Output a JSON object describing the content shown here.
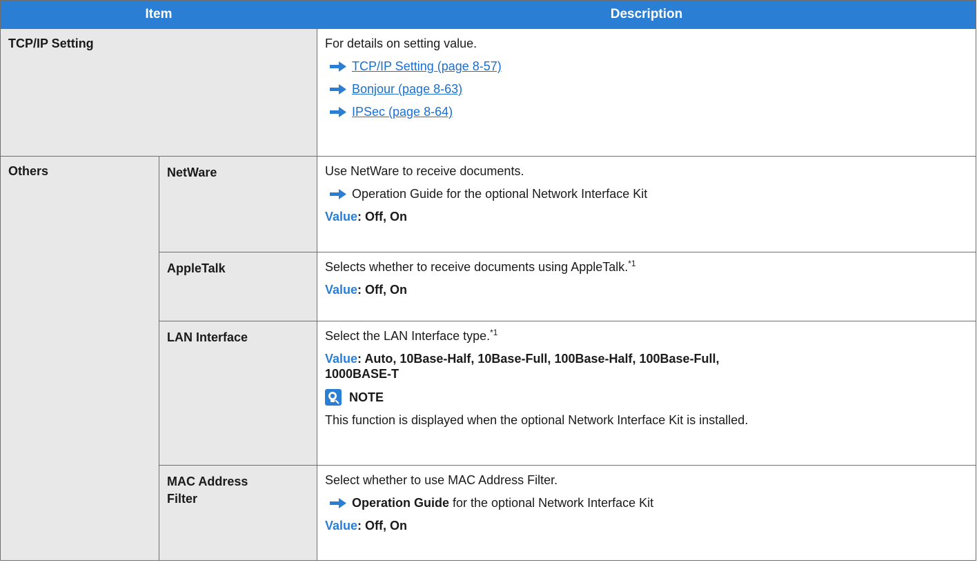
{
  "header": {
    "item": "Item",
    "description": "Description"
  },
  "tcpip": {
    "item": "TCP/IP Setting",
    "intro": "For details on setting value.",
    "links": [
      {
        "text": "TCP/IP Setting (page 8-57)",
        "icon": "right-arrow-icon"
      },
      {
        "text": "Bonjour (page 8-63)",
        "icon": "right-arrow-icon"
      },
      {
        "text": "IPSec (page 8-64)",
        "icon": "right-arrow-icon"
      }
    ]
  },
  "others": {
    "item": "Others",
    "netware": {
      "name": "NetWare",
      "text": "Use NetWare to receive documents.",
      "ref": "Operation Guide for the optional Network Interface Kit",
      "value_label": "Value",
      "value": ": Off, On"
    },
    "appletalk": {
      "name": "AppleTalk",
      "text": "Selects whether to receive documents using AppleTalk.",
      "footnote": "*1",
      "value_label": "Value",
      "value": ": Off, On"
    },
    "lan": {
      "name": "LAN Interface",
      "text": "Select the LAN Interface type.",
      "footnote": "*1",
      "value_label": "Value",
      "value_line1": ": Auto, 10Base-Half, 10Base-Full, 100Base-Half, 100Base-Full,",
      "value_line2": "1000BASE-T",
      "note_label": "NOTE",
      "note_text": "This function is displayed when the optional Network Interface Kit is installed."
    },
    "mac": {
      "name_line1": "MAC Address",
      "name_line2": "Filter",
      "text": "Select whether to use MAC Address Filter.",
      "ref_bold": "Operation Guide",
      "ref_rest": " for the optional Network Interface Kit",
      "value_label": "Value",
      "value": ": Off, On"
    }
  },
  "colors": {
    "header_bg": "#2a7fd4",
    "cell_bg": "#e8e8e8",
    "link": "#1a6fd0",
    "accent": "#2a7fd4"
  }
}
